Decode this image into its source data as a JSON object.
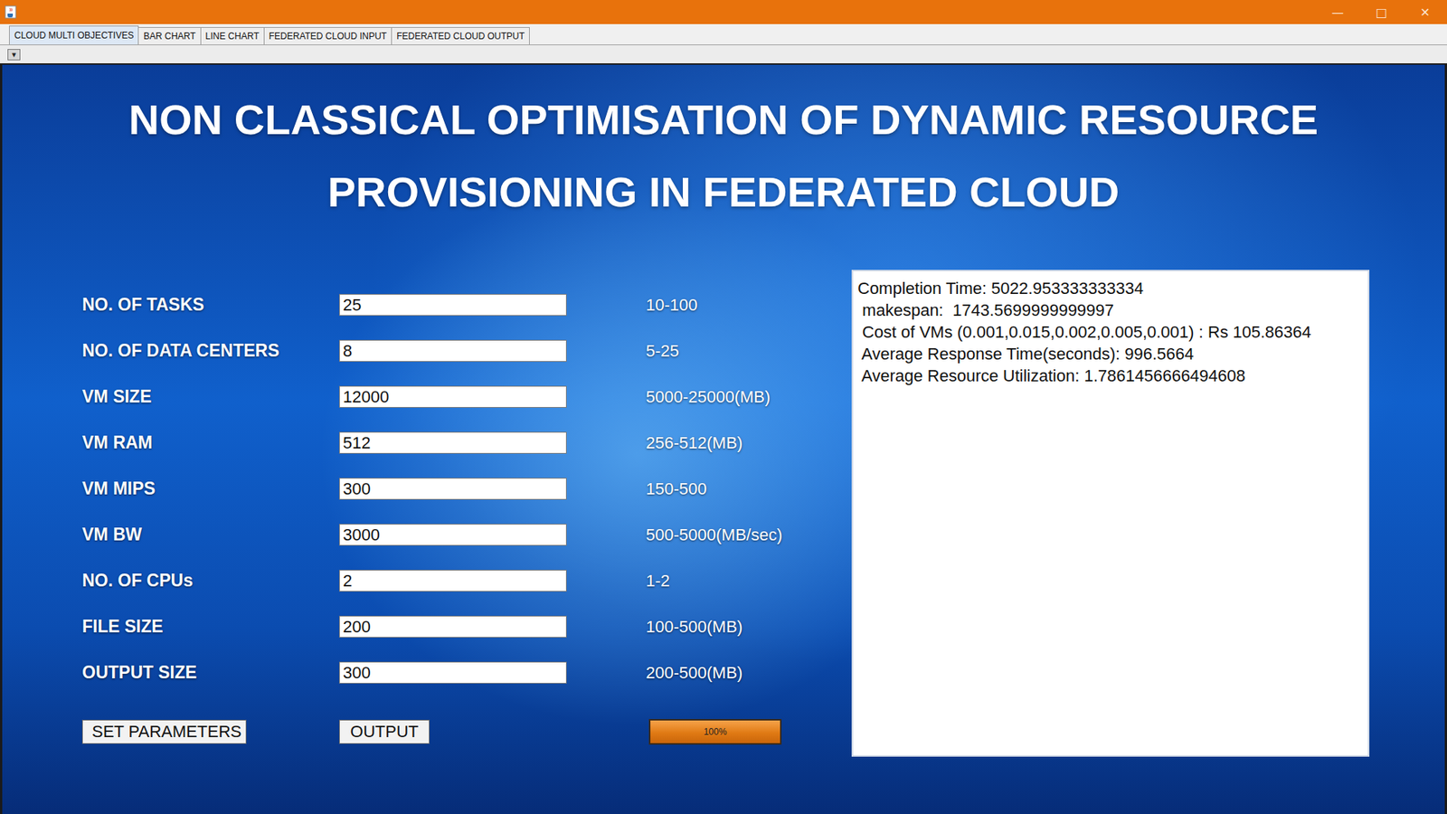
{
  "window": {
    "controls": [
      "—",
      "□",
      "✕"
    ]
  },
  "tabs": [
    {
      "label": "CLOUD MULTI OBJECTIVES",
      "selected": true
    },
    {
      "label": "BAR CHART",
      "selected": false
    },
    {
      "label": "LINE CHART",
      "selected": false
    },
    {
      "label": "FEDERATED CLOUD INPUT",
      "selected": false
    },
    {
      "label": "FEDERATED CLOUD OUTPUT",
      "selected": false
    }
  ],
  "toolbar": {
    "menu_button": "▾"
  },
  "heading": [
    "NON CLASSICAL OPTIMISATION OF DYNAMIC RESOURCE",
    "PROVISIONING IN FEDERATED CLOUD"
  ],
  "fields": [
    {
      "label": "NO. OF TASKS",
      "value": "25",
      "range": "10-100"
    },
    {
      "label": "NO. OF DATA CENTERS",
      "value": "8",
      "range": "5-25"
    },
    {
      "label": "VM SIZE",
      "value": "12000",
      "range": "5000-25000(MB)"
    },
    {
      "label": "VM RAM",
      "value": "512",
      "range": "256-512(MB)"
    },
    {
      "label": "VM MIPS",
      "value": "300",
      "range": "150-500"
    },
    {
      "label": "VM BW",
      "value": "3000",
      "range": "500-5000(MB/sec)"
    },
    {
      "label": "NO. OF CPUs",
      "value": "2",
      "range": "1-2"
    },
    {
      "label": "FILE SIZE",
      "value": "200",
      "range": "100-500(MB)"
    },
    {
      "label": "OUTPUT SIZE",
      "value": "300",
      "range": "200-500(MB)"
    }
  ],
  "buttons": [
    "SET PARAMETERS",
    "OUTPUT"
  ],
  "progress": {
    "level": 1,
    "text": "100%"
  },
  "output": {
    "lines": [
      "Completion Time: 5022.953333333334",
      " makespan:  1743.5699999999997",
      " Cost of VMs (0.001,0.015,0.002,0.005,0.001) : Rs 105.86364",
      " Average Response Time(seconds): 996.5664",
      " Average Resource Utilization: 1.7861456666494608"
    ]
  }
}
